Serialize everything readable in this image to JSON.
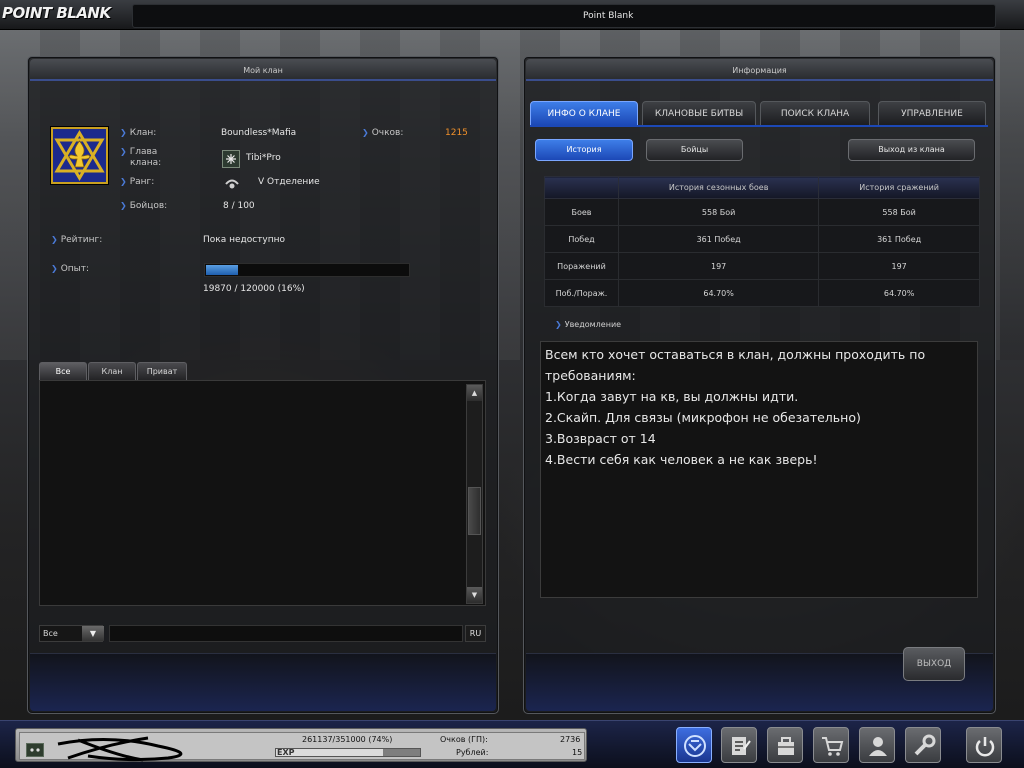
{
  "window": {
    "title": "Point Blank",
    "logo_text": "POINT BLANK"
  },
  "left_panel": {
    "title": "Мой клан",
    "clan": {
      "clan_label": "Клан:",
      "clan_value": "Boundless*Mafia",
      "leader_label_line1": "Глава",
      "leader_label_line2": "клана:",
      "leader_value": "Tibi*Pro",
      "rank_label": "Ранг:",
      "rank_value": "V Отделение",
      "fighters_label": "Бойцов:",
      "fighters_value": "8 / 100",
      "points_label": "Очков:",
      "points_value": "1215",
      "rating_label": "Рейтинг:",
      "rating_value": "Пока недоступно",
      "exp_label": "Опыт:",
      "exp_value": "19870 / 120000 (16%)",
      "exp_fraction": 0.16
    },
    "chat": {
      "tabs": [
        "Все",
        "Клан",
        "Приват"
      ],
      "active_tab": 0,
      "channel": "Все",
      "lang": "RU"
    }
  },
  "right_panel": {
    "title": "Информация",
    "tabs": [
      "ИНФО О КЛАНЕ",
      "КЛАНОВЫЕ БИТВЫ",
      "ПОИСК КЛАНА",
      "УПРАВЛЕНИЕ"
    ],
    "active_tab": 0,
    "sub_buttons": {
      "history": "История",
      "fighters": "Бойцы",
      "leave": "Выход из клана"
    },
    "stats": {
      "headers": [
        "",
        "История сезонных боев",
        "История сражений"
      ],
      "rows": [
        [
          "Боев",
          "558  Бой",
          "558  Бой"
        ],
        [
          "Побед",
          "361 Побед",
          "361 Побед"
        ],
        [
          "Поражений",
          "197",
          "197"
        ],
        [
          "Поб./Пораж.",
          "64.70%",
          "64.70%"
        ]
      ]
    },
    "notice_label": "Уведомление",
    "notice_lines": [
      "Всем кто хочет оставаться в клан, должны проходить по",
      "требованиям:",
      "1.Когда завут на кв, вы должны идти.",
      "2.Скайп. Для связы (микрофон не обезательно)",
      "3.Возвраст от 14",
      "4.Вести себя как человек а не как зверь!"
    ],
    "exit_button": "ВЫХОД"
  },
  "status_bar": {
    "exp_text": "261137/351000 (74%)",
    "exp_fraction": 0.74,
    "exp_label": "EXP",
    "points_label": "Очков (ГП):",
    "points_value": "2736",
    "rubles_label": "Рублей:",
    "rubles_value": "15"
  },
  "toolbar": {
    "icons": [
      "clan-icon",
      "notes-icon",
      "inventory-icon",
      "shop-icon",
      "community-icon",
      "settings-icon",
      "power-icon"
    ],
    "active_icon": "clan-icon"
  },
  "colors": {
    "accent_blue": "#1c48b6",
    "points_orange": "#f0902a",
    "link_blue": "#4a7ad8"
  }
}
